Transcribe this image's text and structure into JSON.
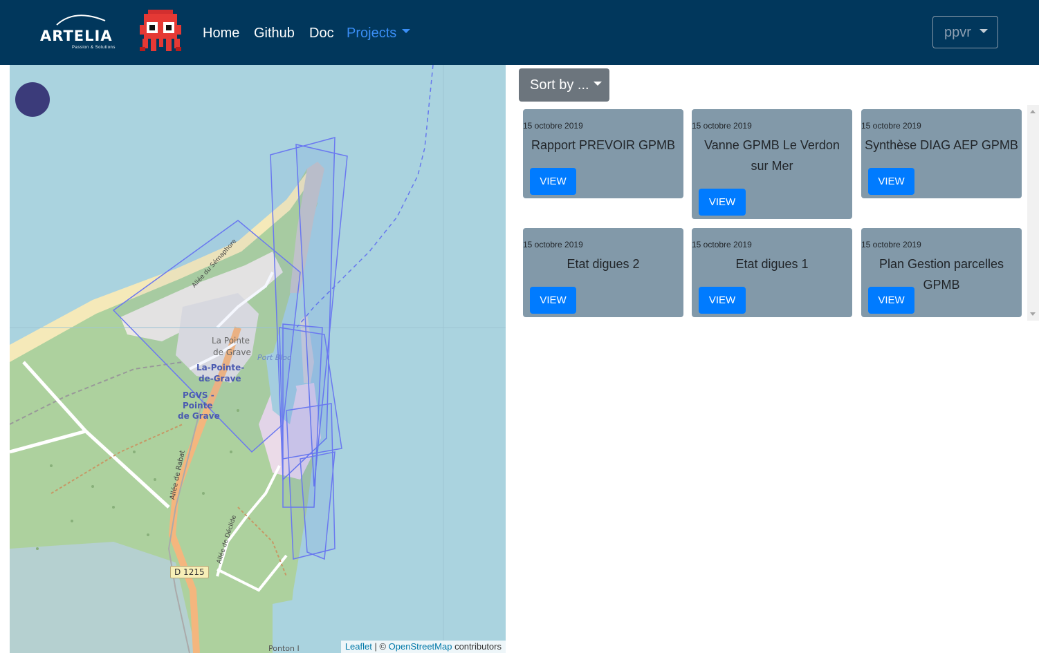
{
  "navbar": {
    "brand_name": "ARTELIA",
    "brand_tagline": "Passion & Solutions",
    "links": {
      "home": "Home",
      "github": "Github",
      "doc": "Doc",
      "projects": "Projects"
    },
    "user_menu_label": "ppvr",
    "colors": {
      "background": "#01375c",
      "active_link": "#3a8ef6"
    }
  },
  "map": {
    "labels": {
      "town_grey": "La Pointe-de Grave",
      "town_grey_line1": "La Pointe",
      "town_grey_line2": "de Grave",
      "port": "Port Bloc",
      "town_blue_line1": "La-Pointe-",
      "town_blue_line2": "de-Grave",
      "station_line1": "PGVS -",
      "station_line2": "Pointe",
      "station_line3": "de Grave",
      "street_semaphore": "Allée du Sémaphore",
      "street_rabat": "Allée de Rabat",
      "street_declide": "Allée de Déclide",
      "road_ref": "D 1215",
      "ponton": "Ponton I"
    },
    "attribution": {
      "leaflet": "Leaflet",
      "separator": " | © ",
      "osm": "OpenStreetMap",
      "suffix": " contributors"
    }
  },
  "sort": {
    "label": "Sort by ..."
  },
  "cards": [
    {
      "date": "15 octobre 2019",
      "title": "Rapport PREVOIR GPMB",
      "button": "VIEW"
    },
    {
      "date": "15 octobre 2019",
      "title": "Vanne GPMB Le Verdon sur Mer",
      "button": "VIEW"
    },
    {
      "date": "15 octobre 2019",
      "title": "Synthèse DIAG AEP GPMB",
      "button": "VIEW"
    },
    {
      "date": "15 octobre 2019",
      "title": "Etat digues 2",
      "button": "VIEW"
    },
    {
      "date": "15 octobre 2019",
      "title": "Etat digues 1",
      "button": "VIEW"
    },
    {
      "date": "15 octobre 2019",
      "title": "Plan Gestion parcelles GPMB",
      "button": "VIEW"
    }
  ]
}
